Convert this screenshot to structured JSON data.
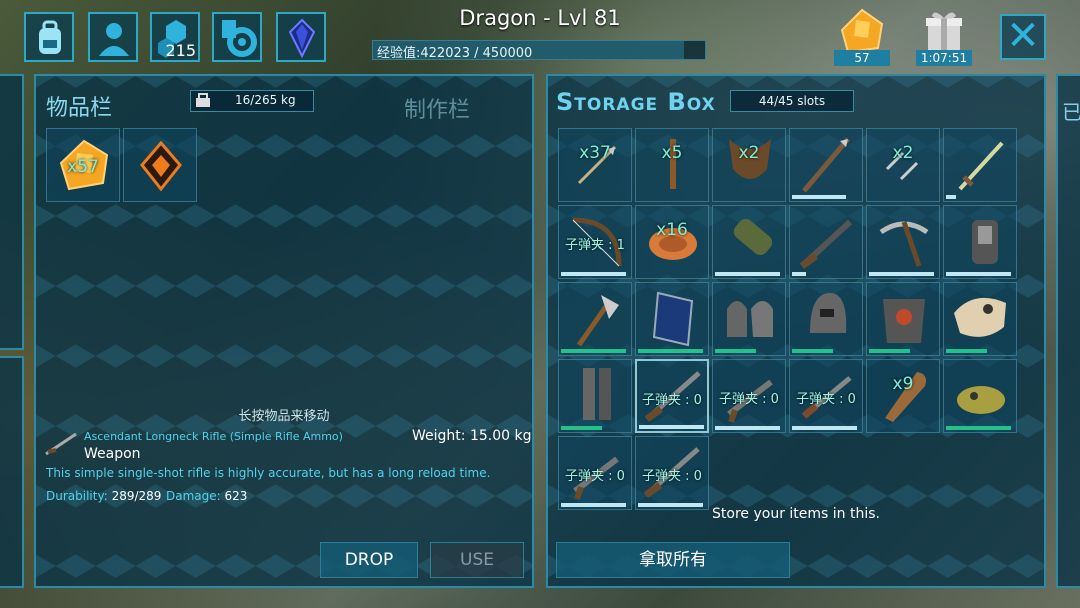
{
  "header": {
    "title": "Dragon - Lvl 81",
    "xp_text": "经验值:422023 / 450000",
    "xp_current": 422023,
    "xp_max": 450000,
    "engrams_count": "215",
    "amber_count": "57",
    "gift_timer": "1:07:51"
  },
  "inventory": {
    "title": "物品栏",
    "craft_tab": "制作栏",
    "weight": "16/265 kg",
    "items": [
      {
        "icon": "amber-icon",
        "qty": "x57"
      },
      {
        "icon": "element-icon",
        "qty": ""
      }
    ],
    "hint": "长按物品来移动"
  },
  "selected_item": {
    "name": "Ascendant Longneck Rifle (Simple Rifle Ammo)",
    "type": "Weapon",
    "weight": "Weight: 15.00 kg",
    "description": "This simple single-shot rifle is highly accurate, but has a long reload time.",
    "durability_label": "Durability:",
    "durability_value": "289/289",
    "damage_label": "Damage:",
    "damage_value": "623"
  },
  "actions": {
    "drop": "DROP",
    "use": "USE"
  },
  "storage": {
    "title": "Storage Box",
    "slots": "44/45 slots",
    "store_hint": "Store your items in this.",
    "take_all": "拿取所有",
    "items": [
      {
        "icon": "arrow-icon",
        "text": "x37",
        "bar": null
      },
      {
        "icon": "stone-arrow-icon",
        "text": "x5",
        "bar": null
      },
      {
        "icon": "chitin-icon",
        "text": "x2",
        "bar": null
      },
      {
        "icon": "spear-icon",
        "text": "",
        "bar": 0.8
      },
      {
        "icon": "bolts-icon",
        "text": "x2",
        "bar": null
      },
      {
        "icon": "sword-icon",
        "text": "",
        "bar": 0.15
      },
      {
        "icon": "bow-icon",
        "text": "子弹夹 : 1",
        "bar": 0.95
      },
      {
        "icon": "meat-icon",
        "text": "x16",
        "bar": null
      },
      {
        "icon": "sleeping-bag-icon",
        "text": "",
        "bar": 0.95
      },
      {
        "icon": "shotgun-icon",
        "text": "",
        "bar": 0.2
      },
      {
        "icon": "pickaxe-icon",
        "text": "",
        "bar": 0.95
      },
      {
        "icon": "metal-hatchet-icon",
        "text": "",
        "bar": 0.95
      },
      {
        "icon": "hatchet-icon",
        "text": "",
        "bar": 0.95
      },
      {
        "icon": "riot-shield-icon",
        "text": "",
        "bar": 0.95
      },
      {
        "icon": "metal-gauntlets-icon",
        "text": "",
        "bar": 0.6
      },
      {
        "icon": "metal-helmet-icon",
        "text": "",
        "bar": 0.6
      },
      {
        "icon": "metal-chestpiece-icon",
        "text": "",
        "bar": 0.6
      },
      {
        "icon": "dino-skull-icon",
        "text": "",
        "bar": 0.6
      },
      {
        "icon": "metal-leggings-icon",
        "text": "",
        "bar": 0.6
      },
      {
        "icon": "longneck-rifle-icon",
        "text": "子弹夹 : 0",
        "bar": 0.95
      },
      {
        "icon": "pistol-icon",
        "text": "子弹夹 : 0",
        "bar": 0.95
      },
      {
        "icon": "flintlock-icon",
        "text": "子弹夹 : 0",
        "bar": 0.95
      },
      {
        "icon": "wood-club-icon",
        "text": "x9",
        "bar": null
      },
      {
        "icon": "trophy-icon",
        "text": "",
        "bar": 0.95
      },
      {
        "icon": "pistol-icon",
        "text": "子弹夹 : 0",
        "bar": 0.95
      },
      {
        "icon": "longneck-rifle-icon",
        "text": "子弹夹 : 0",
        "bar": 0.95
      }
    ]
  }
}
